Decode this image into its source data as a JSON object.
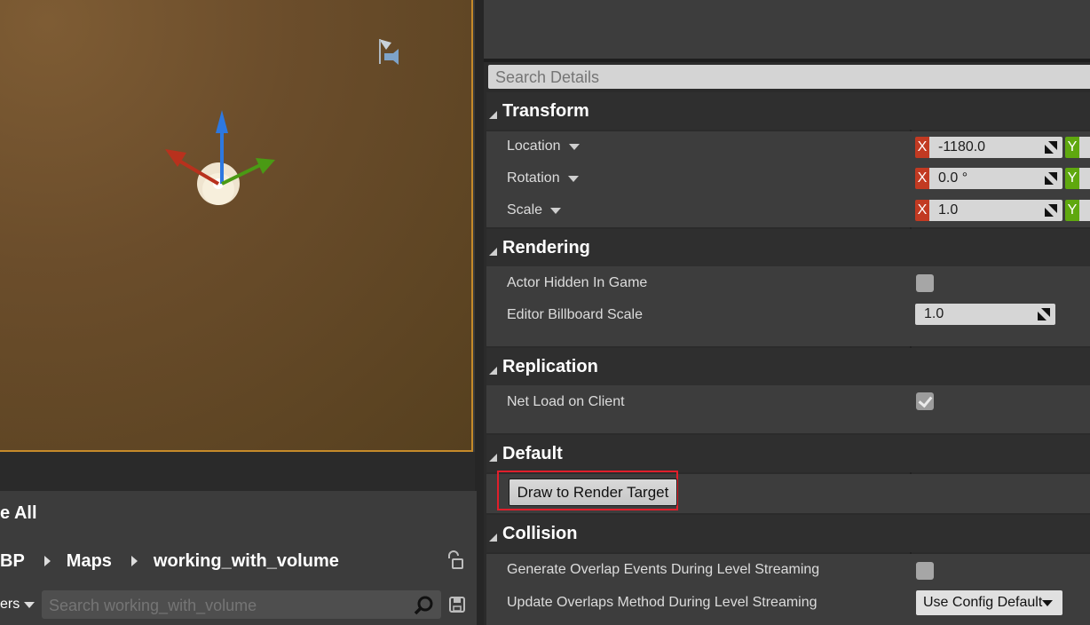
{
  "content_browser": {
    "save_all_label": "e All",
    "breadcrumbs": [
      "BP",
      "Maps",
      "working_with_volume"
    ],
    "filters_label": "ers",
    "search_placeholder": "Search working_with_volume"
  },
  "details": {
    "search_placeholder": "Search Details",
    "categories": {
      "transform": "Transform",
      "rendering": "Rendering",
      "replication": "Replication",
      "default": "Default",
      "collision": "Collision"
    },
    "transform": {
      "location_label": "Location",
      "location_x": "-1180.0",
      "rotation_label": "Rotation",
      "rotation_x": "0.0 °",
      "scale_label": "Scale",
      "scale_x": "1.0",
      "x_axis": "X",
      "y_axis": "Y"
    },
    "rendering": {
      "actor_hidden_label": "Actor Hidden In Game",
      "actor_hidden_checked": false,
      "billboard_scale_label": "Editor Billboard Scale",
      "billboard_scale_value": "1.0"
    },
    "replication": {
      "net_load_label": "Net Load on Client",
      "net_load_checked": true
    },
    "default": {
      "draw_button_label": "Draw to Render Target"
    },
    "collision": {
      "overlap_events_label": "Generate Overlap Events During Level Streaming",
      "overlap_events_checked": false,
      "update_overlaps_label": "Update Overlaps Method During Level Streaming",
      "update_overlaps_value": "Use Config Default"
    }
  },
  "colors": {
    "x_axis": "#c23a22",
    "y_axis": "#5fa80f",
    "highlight": "#e01f2b",
    "viewport_border": "#c58a2a"
  }
}
